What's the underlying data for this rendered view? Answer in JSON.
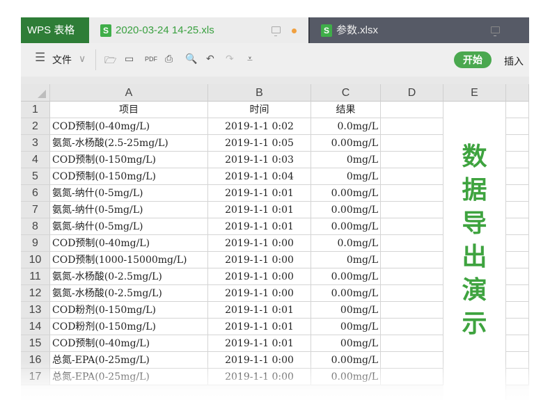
{
  "app": {
    "brand": "WPS 表格"
  },
  "tabs": [
    {
      "label": "2020-03-24 14-25.xls",
      "icon": "S",
      "unsaved": true
    },
    {
      "label": "参数.xlsx",
      "icon": "S"
    }
  ],
  "toolbar": {
    "menu_label": "文件",
    "start": "开始",
    "insert": "插入"
  },
  "columns": [
    "A",
    "B",
    "C",
    "D",
    "E"
  ],
  "header_row": {
    "num": "1",
    "a": "项目",
    "b": "时间",
    "c": "结果"
  },
  "rows": [
    [
      "2",
      "COD预制(0-40mg/L)",
      "2019-1-1 0:02",
      "0.0mg/L"
    ],
    [
      "3",
      "氨氮-水杨酸(2.5-25mg/L)",
      "2019-1-1 0:05",
      "0.00mg/L"
    ],
    [
      "4",
      "COD预制(0-150mg/L)",
      "2019-1-1 0:03",
      "0mg/L"
    ],
    [
      "5",
      "COD预制(0-150mg/L)",
      "2019-1-1 0:04",
      "0mg/L"
    ],
    [
      "6",
      "氨氮-纳什(0-5mg/L)",
      "2019-1-1 0:01",
      "0.00mg/L"
    ],
    [
      "7",
      "氨氮-纳什(0-5mg/L)",
      "2019-1-1 0:01",
      "0.00mg/L"
    ],
    [
      "8",
      "氨氮-纳什(0-5mg/L)",
      "2019-1-1 0:01",
      "0.00mg/L"
    ],
    [
      "9",
      "COD预制(0-40mg/L)",
      "2019-1-1 0:00",
      "0.0mg/L"
    ],
    [
      "10",
      "COD预制(1000-15000mg/L)",
      "2019-1-1 0:00",
      "0mg/L"
    ],
    [
      "11",
      "氨氮-水杨酸(0-2.5mg/L)",
      "2019-1-1 0:00",
      "0.00mg/L"
    ],
    [
      "12",
      "氨氮-水杨酸(0-2.5mg/L)",
      "2019-1-1 0:00",
      "0.00mg/L"
    ],
    [
      "13",
      "COD粉剂(0-150mg/L)",
      "2019-1-1 0:01",
      "00mg/L"
    ],
    [
      "14",
      "COD粉剂(0-150mg/L)",
      "2019-1-1 0:01",
      "00mg/L"
    ],
    [
      "15",
      "COD预制(0-40mg/L)",
      "2019-1-1 0:01",
      "00mg/L"
    ],
    [
      "16",
      "总氮-EPA(0-25mg/L)",
      "2019-1-1 0:00",
      "0.00mg/L"
    ],
    [
      "17",
      "总氮-EPA(0-25mg/L)",
      "2019-1-1 0:00",
      "0.00mg/L"
    ]
  ],
  "merged_text": [
    "数",
    "据",
    "导",
    "出",
    "演",
    "示"
  ],
  "colors": {
    "brand": "#2e7d37",
    "accent": "#3ea33f",
    "inactive_tab": "#565a66"
  }
}
